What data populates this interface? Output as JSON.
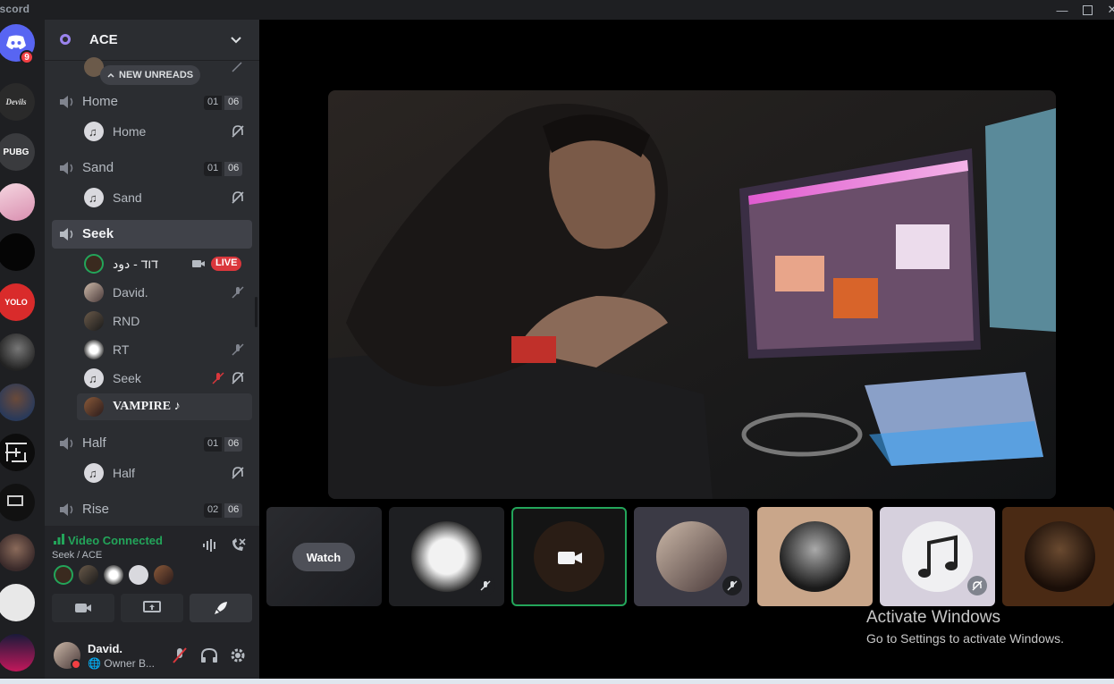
{
  "app": {
    "title": "iscord"
  },
  "window": {
    "minimize": "minimize-icon",
    "maximize": "maximize-icon",
    "close": "close-icon"
  },
  "servers": {
    "home_badge": "9",
    "items": [
      "Devils",
      "PUBG",
      "YOLO"
    ]
  },
  "guild": {
    "name": "ACE"
  },
  "new_unreads": {
    "label": "NEW UNREADS"
  },
  "channels": [
    {
      "name": "Home",
      "count": "01",
      "limit": "06",
      "users": [
        {
          "name": "Home"
        }
      ]
    },
    {
      "name": "Sand",
      "count": "01",
      "limit": "06",
      "users": [
        {
          "name": "Sand"
        }
      ]
    },
    {
      "name": "Seek",
      "users": [
        {
          "name": "דוד - دود",
          "badge": "LIVE"
        },
        {
          "name": "David."
        },
        {
          "name": "RND"
        },
        {
          "name": "RT"
        },
        {
          "name": "Seek"
        },
        {
          "name": "VAMPIRE ♪"
        }
      ]
    },
    {
      "name": "Half",
      "count": "01",
      "limit": "06",
      "users": [
        {
          "name": "Half"
        }
      ]
    },
    {
      "name": "Rise",
      "count": "02",
      "limit": "06"
    }
  ],
  "voice": {
    "status": "Video Connected",
    "location": "Seek / ACE"
  },
  "me": {
    "name": "David.",
    "status": "Owner B..."
  },
  "stage": {
    "watch_label": "Watch"
  },
  "watermark": {
    "title": "Activate Windows",
    "subtitle": "Go to Settings to activate Windows."
  },
  "colors": {
    "accent_green": "#23a55a",
    "live_red": "#da373c",
    "sidebar": "#2b2d31",
    "rail": "#1e1f22"
  }
}
